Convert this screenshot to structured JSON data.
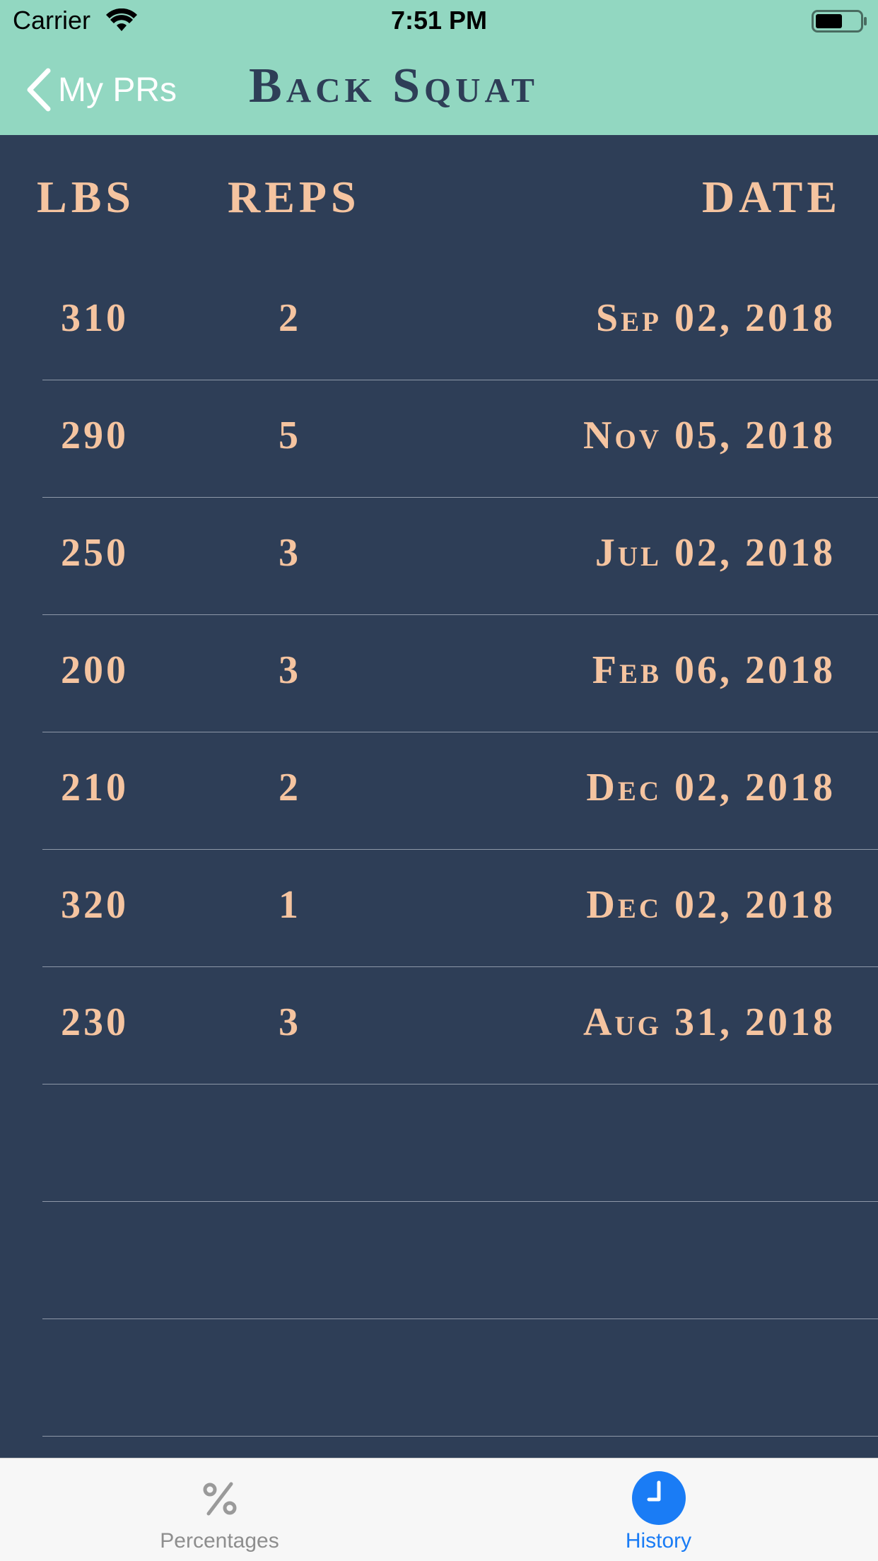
{
  "status_bar": {
    "carrier": "Carrier",
    "time": "7:51 PM",
    "battery_level": 0.6
  },
  "nav": {
    "back_label": "My PRs",
    "title": "Back Squat"
  },
  "table": {
    "headers": {
      "lbs": "LBS",
      "reps": "REPS",
      "date": "DATE"
    },
    "rows": [
      {
        "lbs": "310",
        "reps": "2",
        "date": "Sep 02, 2018"
      },
      {
        "lbs": "290",
        "reps": "5",
        "date": "Nov 05, 2018"
      },
      {
        "lbs": "250",
        "reps": "3",
        "date": "Jul 02, 2018"
      },
      {
        "lbs": "200",
        "reps": "3",
        "date": "Feb 06, 2018"
      },
      {
        "lbs": "210",
        "reps": "2",
        "date": "Dec 02, 2018"
      },
      {
        "lbs": "320",
        "reps": "1",
        "date": "Dec 02, 2018"
      },
      {
        "lbs": "230",
        "reps": "3",
        "date": "Aug 31, 2018"
      },
      {
        "lbs": "",
        "reps": "",
        "date": ""
      },
      {
        "lbs": "",
        "reps": "",
        "date": ""
      },
      {
        "lbs": "",
        "reps": "",
        "date": ""
      }
    ]
  },
  "tabs": [
    {
      "label": "Percentages",
      "icon": "percent-icon",
      "selected": false
    },
    {
      "label": "History",
      "icon": "clock-icon",
      "selected": true
    }
  ],
  "colors": {
    "nav_bar": "#92d7c1",
    "background": "#2e3e57",
    "accent_text": "#f5c4a0",
    "title_text": "#2e3e57",
    "tab_selected": "#1a7cf5",
    "tab_unselected": "#8e8e8e"
  }
}
